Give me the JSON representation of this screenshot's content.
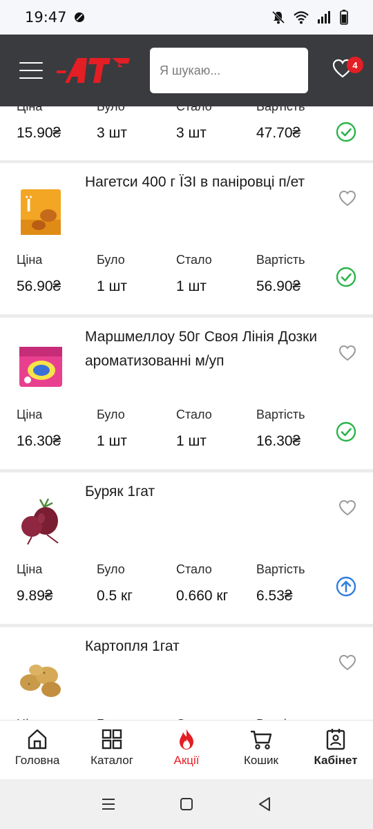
{
  "status_bar": {
    "time": "19:47"
  },
  "header": {
    "search_placeholder": "Я шукаю...",
    "favorites_count": "4",
    "brand_color": "#e31e24"
  },
  "columns": {
    "price": "Ціна",
    "was": "Було",
    "now": "Стало",
    "total": "Вартість"
  },
  "items": [
    {
      "name": "",
      "price": "15.90₴",
      "was": "3 шт",
      "now": "3 шт",
      "total": "47.70₴",
      "status": "check-circle-icon"
    },
    {
      "name": "Нагетси 400 г ЇЗІ в паніровці п/ет",
      "price": "56.90₴",
      "was": "1 шт",
      "now": "1 шт",
      "total": "56.90₴",
      "status": "check-circle-icon"
    },
    {
      "name": "Маршмеллоу 50г Своя Лінія Дозки ароматизованні м/уп",
      "price": "16.30₴",
      "was": "1 шт",
      "now": "1 шт",
      "total": "16.30₴",
      "status": "check-circle-icon"
    },
    {
      "name": "Буряк 1гат",
      "price": "9.89₴",
      "was": "0.5 кг",
      "now": "0.660 кг",
      "total": "6.53₴",
      "status": "arrow-up-circle-icon"
    },
    {
      "name": "Картопля 1гат",
      "price": "",
      "was": "",
      "now": "",
      "total": "",
      "status": ""
    }
  ],
  "bottom_nav": [
    {
      "label": "Головна",
      "icon": "home-icon"
    },
    {
      "label": "Каталог",
      "icon": "catalog-icon"
    },
    {
      "label": "Акції",
      "icon": "flame-icon",
      "active": true
    },
    {
      "label": "Кошик",
      "icon": "cart-icon"
    },
    {
      "label": "Кабінет",
      "icon": "cabinet-icon",
      "bold": true
    }
  ],
  "colors": {
    "green": "#2bb34a",
    "blue": "#2f7de1",
    "header_bg": "#3a3b3e"
  }
}
